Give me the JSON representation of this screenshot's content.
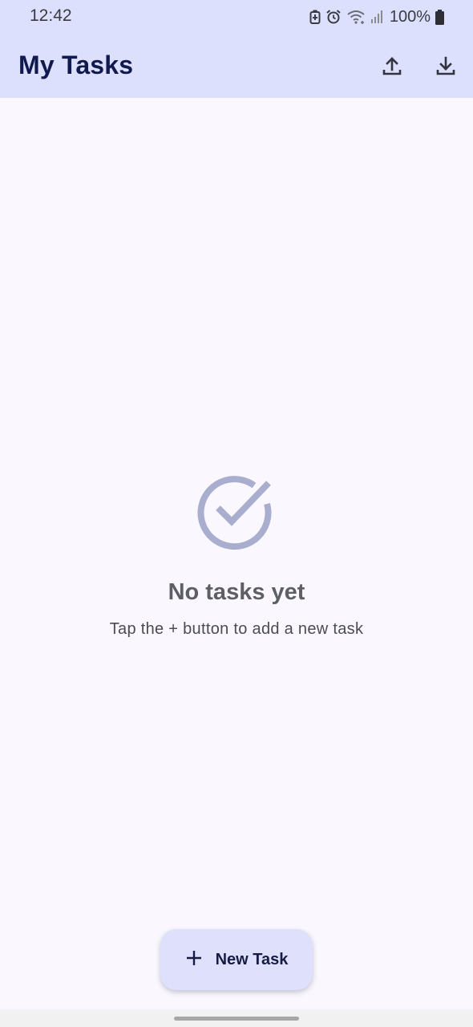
{
  "status_bar": {
    "time": "12:42",
    "battery_percent": "100%",
    "icons": [
      "battery-saver-icon",
      "alarm-icon",
      "wifi-icon",
      "signal-icon",
      "battery-icon"
    ]
  },
  "app_bar": {
    "title": "My Tasks",
    "actions": [
      "upload-icon",
      "download-icon"
    ]
  },
  "empty_state": {
    "icon": "check-circle-icon",
    "title": "No tasks yet",
    "subtitle": "Tap the + button to add a new task"
  },
  "fab": {
    "icon": "plus-icon",
    "label": "New Task"
  },
  "colors": {
    "app_bar_bg": "#dde0fc",
    "page_bg": "#faf8fe",
    "title_text": "#111a4f",
    "empty_icon": "#a9aece",
    "fab_bg": "#dfe0fb"
  }
}
